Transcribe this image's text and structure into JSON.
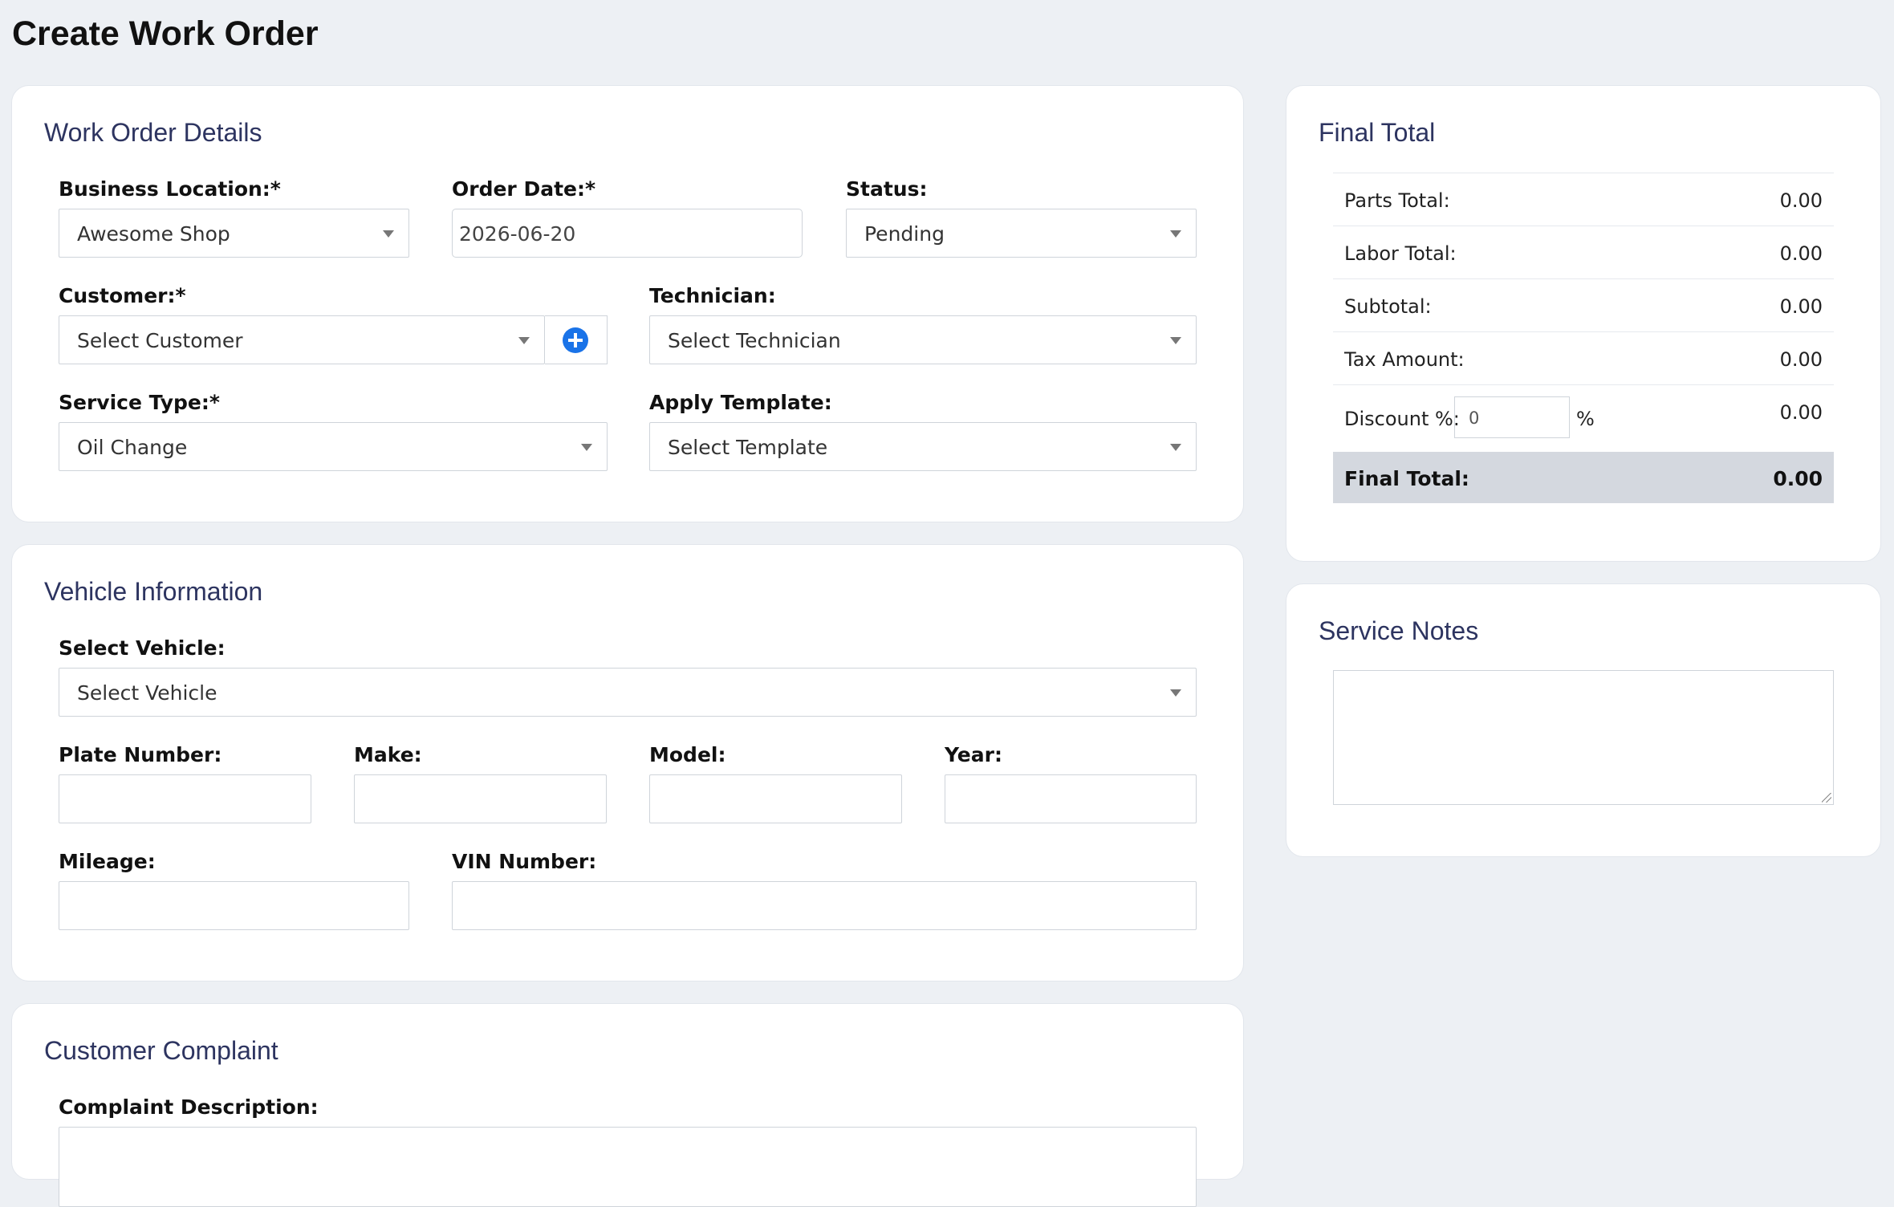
{
  "page": {
    "title": "Create Work Order"
  },
  "work_order_details": {
    "title": "Work Order Details",
    "business_location": {
      "label": "Business Location:*",
      "value": "Awesome Shop"
    },
    "order_date": {
      "label": "Order Date:*",
      "value": "2026-06-20"
    },
    "status": {
      "label": "Status:",
      "value": "Pending"
    },
    "customer": {
      "label": "Customer:*",
      "value": "Select Customer",
      "add_icon": "plus-circle-icon"
    },
    "technician": {
      "label": "Technician:",
      "value": "Select Technician"
    },
    "service_type": {
      "label": "Service Type:*",
      "value": "Oil Change"
    },
    "apply_template": {
      "label": "Apply Template:",
      "value": "Select Template"
    }
  },
  "vehicle_information": {
    "title": "Vehicle Information",
    "select_vehicle": {
      "label": "Select Vehicle:",
      "value": "Select Vehicle"
    },
    "plate_number": {
      "label": "Plate Number:",
      "value": ""
    },
    "make": {
      "label": "Make:",
      "value": ""
    },
    "model": {
      "label": "Model:",
      "value": ""
    },
    "year": {
      "label": "Year:",
      "value": ""
    },
    "mileage": {
      "label": "Mileage:",
      "value": ""
    },
    "vin_number": {
      "label": "VIN Number:",
      "value": ""
    }
  },
  "customer_complaint": {
    "title": "Customer Complaint",
    "complaint_description": {
      "label": "Complaint Description:"
    }
  },
  "final_total": {
    "title": "Final Total",
    "rows": [
      {
        "label": "Parts Total:",
        "value": "0.00"
      },
      {
        "label": "Labor Total:",
        "value": "0.00"
      },
      {
        "label": "Subtotal:",
        "value": "0.00"
      },
      {
        "label": "Tax Amount:",
        "value": "0.00"
      }
    ],
    "discount": {
      "label": "Discount %:",
      "input_value": "0",
      "suffix": "%",
      "value": "0.00"
    },
    "final": {
      "label": "Final Total:",
      "value": "0.00"
    }
  },
  "service_notes": {
    "title": "Service Notes",
    "value": ""
  },
  "colors": {
    "background": "#edf0f4",
    "card_title": "#2d3460",
    "accent": "#1a73e8",
    "final_row_bg": "#d4d8df"
  }
}
